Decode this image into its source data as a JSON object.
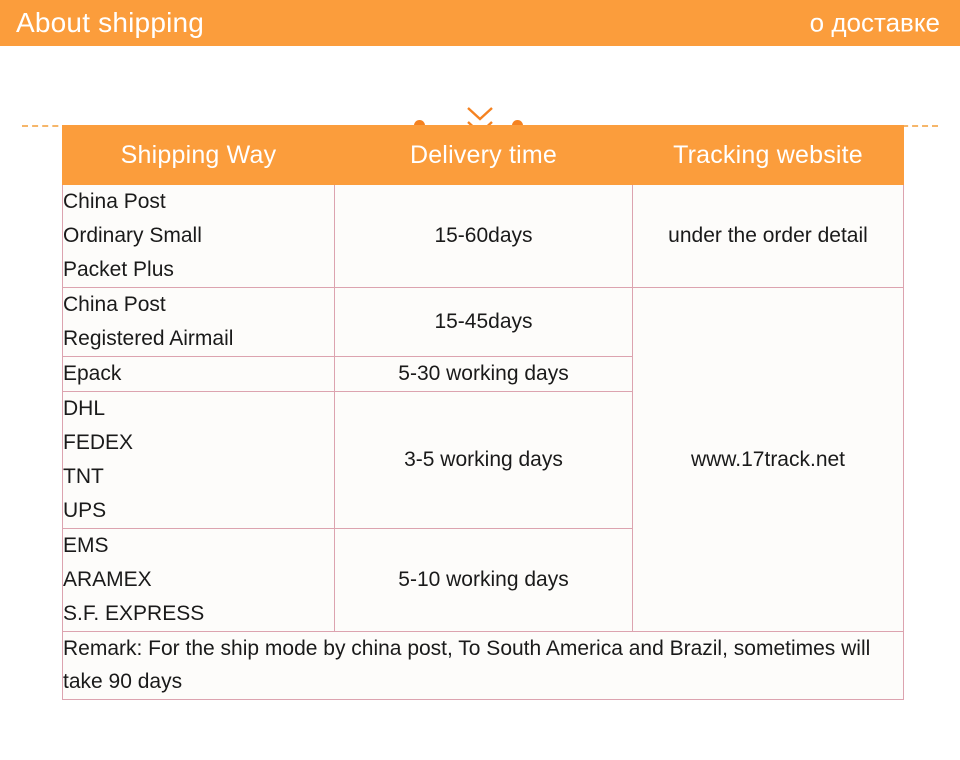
{
  "banner": {
    "title_en": "About shipping",
    "title_ru": "о доставке",
    "background_color": "#fb9d3c",
    "text_color": "#ffffff"
  },
  "divider": {
    "icon": "double-chevron-down",
    "line_color": "#f6b66a",
    "dot_color": "#f58220"
  },
  "table": {
    "header_background": "#fb9d3c",
    "border_color": "#dca3af",
    "cell_background": "#fdfcfa",
    "columns": [
      "Shipping Way",
      "Delivery time",
      "Tracking website"
    ],
    "rows": [
      {
        "way_lines": [
          "China Post",
          "Ordinary Small",
          "Packet Plus"
        ],
        "delivery_time": "15-60days",
        "tracking": "under the order detail"
      },
      {
        "way_lines": [
          "China Post",
          "Registered Airmail"
        ],
        "delivery_time": "15-45days",
        "tracking": "www.17track.net"
      },
      {
        "way_lines": [
          "Epack"
        ],
        "delivery_time": "5-30 working days",
        "tracking": ""
      },
      {
        "way_lines": [
          "DHL",
          "FEDEX",
          "TNT",
          "UPS"
        ],
        "delivery_time": "3-5 working days",
        "tracking": ""
      },
      {
        "way_lines": [
          "EMS",
          "ARAMEX",
          "S.F. EXPRESS"
        ],
        "delivery_time": "5-10 working days",
        "tracking": ""
      }
    ],
    "remark": "Remark: For the ship mode by china post, To South America and Brazil, sometimes will take 90 days"
  }
}
